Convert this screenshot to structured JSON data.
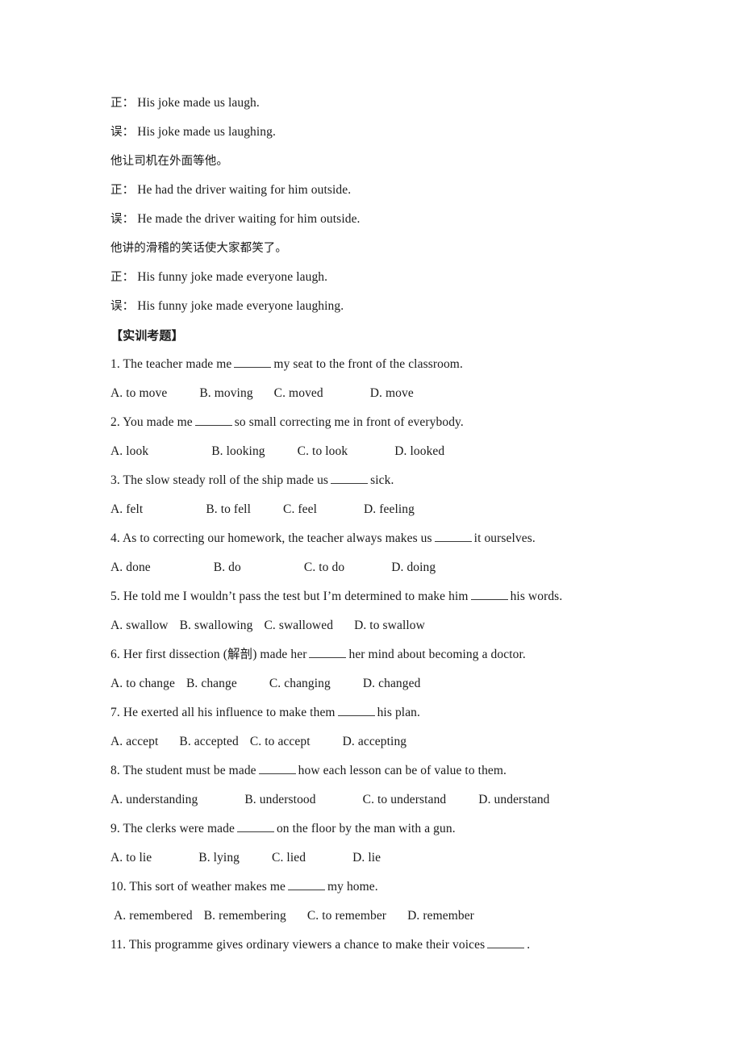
{
  "document": {
    "examples": [
      {
        "marker": "正：",
        "text": "His joke made us laugh."
      },
      {
        "marker": "误：",
        "text": "His joke made us laughing."
      },
      {
        "chinese": "他让司机在外面等他。"
      },
      {
        "marker": "正：",
        "text": "He had the driver waiting for him outside."
      },
      {
        "marker": "误：",
        "text": "He made the driver waiting for him outside."
      },
      {
        "chinese": "他讲的滑稽的笑话使大家都笑了。"
      },
      {
        "marker": "正：",
        "text": "His funny joke made everyone laugh."
      },
      {
        "marker": "误：",
        "text": "His funny joke made everyone laughing."
      }
    ],
    "section_heading": "【实训考题】",
    "questions": [
      {
        "number": "1.",
        "stem_before": "The teacher made me",
        "stem_after": "my seat to the front of the classroom.",
        "options": [
          "A. to move",
          "B. moving",
          "C. moved",
          "D. move"
        ],
        "gaps": [
          "g-lg",
          "g-md",
          "g-xl"
        ]
      },
      {
        "number": "2.",
        "stem_before": "You made me",
        "stem_after": "so small correcting me in front of everybody.",
        "options": [
          "A. look",
          "B. looking",
          "C. to look",
          "D. looked"
        ],
        "gaps": [
          "g-xxl",
          "g-lg",
          "g-xl"
        ]
      },
      {
        "number": "3.",
        "stem_before": "The slow steady roll of the ship made us",
        "stem_after": "sick.",
        "options": [
          "A. felt",
          "B. to fell",
          "C. feel",
          "D. feeling"
        ],
        "gaps": [
          "g-xxl",
          "g-lg",
          "g-xl"
        ]
      },
      {
        "number": "4.",
        "stem_before": "As to correcting our homework, the teacher always makes us",
        "stem_after": "it ourselves.",
        "options": [
          "A. done",
          "B. do",
          "C. to do",
          "D. doing"
        ],
        "gaps": [
          "g-xxl",
          "g-xxl",
          "g-xl"
        ]
      },
      {
        "number": "5.",
        "stem_before": "He told me I wouldn’t pass the test but I’m determined to make him",
        "stem_after": "his words.",
        "options": [
          "A. swallow",
          "B. swallowing",
          "C. swallowed",
          "D. to swallow"
        ],
        "gaps": [
          "g-sm",
          "g-sm",
          "g-md"
        ]
      },
      {
        "number": "6.",
        "stem_before": "Her first dissection (解剖) made her",
        "stem_after": "her mind about becoming a doctor.",
        "options": [
          "A. to change",
          "B. change",
          "C. changing",
          "D. changed"
        ],
        "gaps": [
          "g-sm",
          "g-lg",
          "g-lg"
        ]
      },
      {
        "number": "7.",
        "stem_before": "He exerted all his influence to make them",
        "stem_after": "his plan.",
        "options": [
          "A. accept",
          "B. accepted",
          "C. to accept",
          "D. accepting"
        ],
        "gaps": [
          "g-md",
          "g-sm",
          "g-lg"
        ]
      },
      {
        "number": "8.",
        "stem_before": "The student must be made",
        "stem_after": "how each lesson can be of value to them.",
        "options": [
          "A. understanding",
          "B. understood",
          "C. to understand",
          "D. understand"
        ],
        "gaps": [
          "g-xl",
          "g-xl",
          "g-lg"
        ]
      },
      {
        "number": "9.",
        "stem_before": "The clerks were made",
        "stem_after": "on the floor by the man with a gun.",
        "options": [
          "A. to lie",
          "B. lying",
          "C. lied",
          "D. lie"
        ],
        "gaps": [
          "g-xl",
          "g-lg",
          "g-xl"
        ]
      },
      {
        "number": "10.",
        "stem_before": "This sort of weather makes me",
        "stem_after": "my home.",
        "options": [
          "A. remembered",
          "B. remembering",
          "C. to remember",
          "D. remember"
        ],
        "gaps": [
          "g-sm",
          "g-md",
          "g-md"
        ],
        "options_indented": true
      },
      {
        "number": "11.",
        "stem_before": "This programme gives ordinary viewers a chance to make their voices",
        "stem_after": ".",
        "options": [],
        "gaps": []
      }
    ]
  }
}
